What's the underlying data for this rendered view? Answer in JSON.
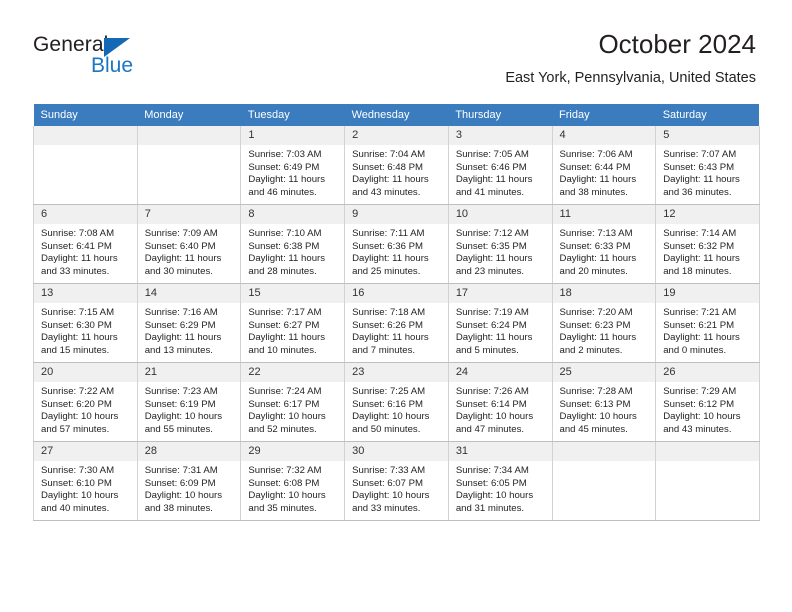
{
  "logo": {
    "word1": "General",
    "word2": "Blue",
    "triangle_color": "#1469b5",
    "blue_color": "#1b76c4"
  },
  "header": {
    "title": "October 2024",
    "location": "East York, Pennsylvania, United States"
  },
  "calendar": {
    "header_bg": "#3a7cbe",
    "daynum_bg": "#f0f0f0",
    "weekdays": [
      "Sunday",
      "Monday",
      "Tuesday",
      "Wednesday",
      "Thursday",
      "Friday",
      "Saturday"
    ],
    "weeks": [
      [
        {
          "day": "",
          "sunrise": "",
          "sunset": "",
          "daylight": "",
          "empty": true
        },
        {
          "day": "",
          "sunrise": "",
          "sunset": "",
          "daylight": "",
          "empty": true
        },
        {
          "day": "1",
          "sunrise": "Sunrise: 7:03 AM",
          "sunset": "Sunset: 6:49 PM",
          "daylight": "Daylight: 11 hours and 46 minutes."
        },
        {
          "day": "2",
          "sunrise": "Sunrise: 7:04 AM",
          "sunset": "Sunset: 6:48 PM",
          "daylight": "Daylight: 11 hours and 43 minutes."
        },
        {
          "day": "3",
          "sunrise": "Sunrise: 7:05 AM",
          "sunset": "Sunset: 6:46 PM",
          "daylight": "Daylight: 11 hours and 41 minutes."
        },
        {
          "day": "4",
          "sunrise": "Sunrise: 7:06 AM",
          "sunset": "Sunset: 6:44 PM",
          "daylight": "Daylight: 11 hours and 38 minutes."
        },
        {
          "day": "5",
          "sunrise": "Sunrise: 7:07 AM",
          "sunset": "Sunset: 6:43 PM",
          "daylight": "Daylight: 11 hours and 36 minutes."
        }
      ],
      [
        {
          "day": "6",
          "sunrise": "Sunrise: 7:08 AM",
          "sunset": "Sunset: 6:41 PM",
          "daylight": "Daylight: 11 hours and 33 minutes."
        },
        {
          "day": "7",
          "sunrise": "Sunrise: 7:09 AM",
          "sunset": "Sunset: 6:40 PM",
          "daylight": "Daylight: 11 hours and 30 minutes."
        },
        {
          "day": "8",
          "sunrise": "Sunrise: 7:10 AM",
          "sunset": "Sunset: 6:38 PM",
          "daylight": "Daylight: 11 hours and 28 minutes."
        },
        {
          "day": "9",
          "sunrise": "Sunrise: 7:11 AM",
          "sunset": "Sunset: 6:36 PM",
          "daylight": "Daylight: 11 hours and 25 minutes."
        },
        {
          "day": "10",
          "sunrise": "Sunrise: 7:12 AM",
          "sunset": "Sunset: 6:35 PM",
          "daylight": "Daylight: 11 hours and 23 minutes."
        },
        {
          "day": "11",
          "sunrise": "Sunrise: 7:13 AM",
          "sunset": "Sunset: 6:33 PM",
          "daylight": "Daylight: 11 hours and 20 minutes."
        },
        {
          "day": "12",
          "sunrise": "Sunrise: 7:14 AM",
          "sunset": "Sunset: 6:32 PM",
          "daylight": "Daylight: 11 hours and 18 minutes."
        }
      ],
      [
        {
          "day": "13",
          "sunrise": "Sunrise: 7:15 AM",
          "sunset": "Sunset: 6:30 PM",
          "daylight": "Daylight: 11 hours and 15 minutes."
        },
        {
          "day": "14",
          "sunrise": "Sunrise: 7:16 AM",
          "sunset": "Sunset: 6:29 PM",
          "daylight": "Daylight: 11 hours and 13 minutes."
        },
        {
          "day": "15",
          "sunrise": "Sunrise: 7:17 AM",
          "sunset": "Sunset: 6:27 PM",
          "daylight": "Daylight: 11 hours and 10 minutes."
        },
        {
          "day": "16",
          "sunrise": "Sunrise: 7:18 AM",
          "sunset": "Sunset: 6:26 PM",
          "daylight": "Daylight: 11 hours and 7 minutes."
        },
        {
          "day": "17",
          "sunrise": "Sunrise: 7:19 AM",
          "sunset": "Sunset: 6:24 PM",
          "daylight": "Daylight: 11 hours and 5 minutes."
        },
        {
          "day": "18",
          "sunrise": "Sunrise: 7:20 AM",
          "sunset": "Sunset: 6:23 PM",
          "daylight": "Daylight: 11 hours and 2 minutes."
        },
        {
          "day": "19",
          "sunrise": "Sunrise: 7:21 AM",
          "sunset": "Sunset: 6:21 PM",
          "daylight": "Daylight: 11 hours and 0 minutes."
        }
      ],
      [
        {
          "day": "20",
          "sunrise": "Sunrise: 7:22 AM",
          "sunset": "Sunset: 6:20 PM",
          "daylight": "Daylight: 10 hours and 57 minutes."
        },
        {
          "day": "21",
          "sunrise": "Sunrise: 7:23 AM",
          "sunset": "Sunset: 6:19 PM",
          "daylight": "Daylight: 10 hours and 55 minutes."
        },
        {
          "day": "22",
          "sunrise": "Sunrise: 7:24 AM",
          "sunset": "Sunset: 6:17 PM",
          "daylight": "Daylight: 10 hours and 52 minutes."
        },
        {
          "day": "23",
          "sunrise": "Sunrise: 7:25 AM",
          "sunset": "Sunset: 6:16 PM",
          "daylight": "Daylight: 10 hours and 50 minutes."
        },
        {
          "day": "24",
          "sunrise": "Sunrise: 7:26 AM",
          "sunset": "Sunset: 6:14 PM",
          "daylight": "Daylight: 10 hours and 47 minutes."
        },
        {
          "day": "25",
          "sunrise": "Sunrise: 7:28 AM",
          "sunset": "Sunset: 6:13 PM",
          "daylight": "Daylight: 10 hours and 45 minutes."
        },
        {
          "day": "26",
          "sunrise": "Sunrise: 7:29 AM",
          "sunset": "Sunset: 6:12 PM",
          "daylight": "Daylight: 10 hours and 43 minutes."
        }
      ],
      [
        {
          "day": "27",
          "sunrise": "Sunrise: 7:30 AM",
          "sunset": "Sunset: 6:10 PM",
          "daylight": "Daylight: 10 hours and 40 minutes."
        },
        {
          "day": "28",
          "sunrise": "Sunrise: 7:31 AM",
          "sunset": "Sunset: 6:09 PM",
          "daylight": "Daylight: 10 hours and 38 minutes."
        },
        {
          "day": "29",
          "sunrise": "Sunrise: 7:32 AM",
          "sunset": "Sunset: 6:08 PM",
          "daylight": "Daylight: 10 hours and 35 minutes."
        },
        {
          "day": "30",
          "sunrise": "Sunrise: 7:33 AM",
          "sunset": "Sunset: 6:07 PM",
          "daylight": "Daylight: 10 hours and 33 minutes."
        },
        {
          "day": "31",
          "sunrise": "Sunrise: 7:34 AM",
          "sunset": "Sunset: 6:05 PM",
          "daylight": "Daylight: 10 hours and 31 minutes."
        },
        {
          "day": "",
          "sunrise": "",
          "sunset": "",
          "daylight": "",
          "empty": true
        },
        {
          "day": "",
          "sunrise": "",
          "sunset": "",
          "daylight": "",
          "empty": true
        }
      ]
    ]
  }
}
